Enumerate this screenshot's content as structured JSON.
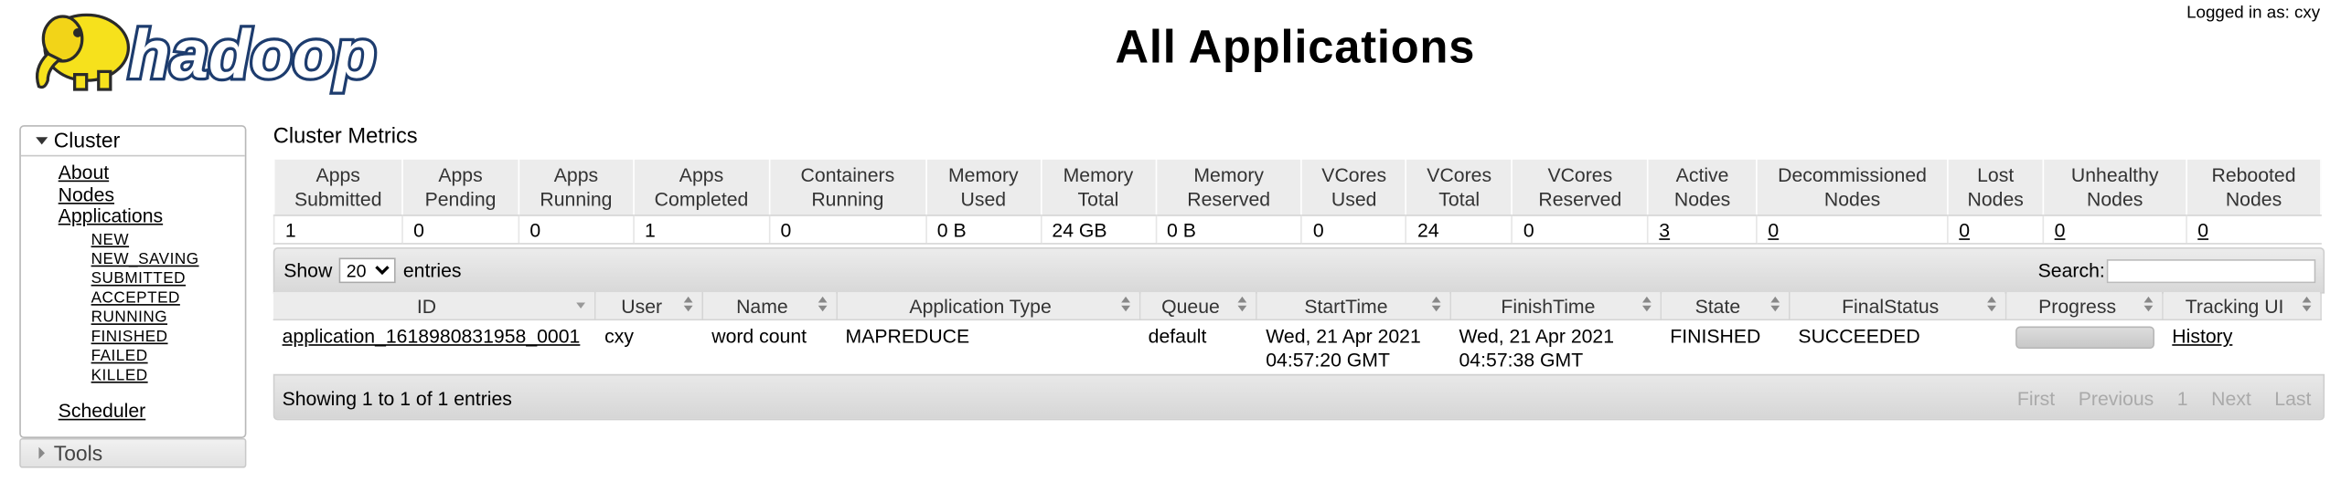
{
  "header": {
    "logo_text": "hadoop",
    "title": "All Applications",
    "logged_in": "Logged in as: cxy"
  },
  "sidebar": {
    "cluster_label": "Cluster",
    "links": [
      "About",
      "Nodes",
      "Applications"
    ],
    "app_states": [
      "NEW",
      "NEW_SAVING",
      "SUBMITTED",
      "ACCEPTED",
      "RUNNING",
      "FINISHED",
      "FAILED",
      "KILLED"
    ],
    "scheduler": "Scheduler",
    "tools_label": "Tools"
  },
  "metrics": {
    "title": "Cluster Metrics",
    "headers": [
      [
        "Apps",
        "Submitted"
      ],
      [
        "Apps",
        "Pending"
      ],
      [
        "Apps",
        "Running"
      ],
      [
        "Apps",
        "Completed"
      ],
      [
        "Containers",
        "Running"
      ],
      [
        "Memory",
        "Used"
      ],
      [
        "Memory",
        "Total"
      ],
      [
        "Memory",
        "Reserved"
      ],
      [
        "VCores",
        "Used"
      ],
      [
        "VCores",
        "Total"
      ],
      [
        "VCores",
        "Reserved"
      ],
      [
        "Active",
        "Nodes"
      ],
      [
        "Decommissioned",
        "Nodes"
      ],
      [
        "Lost",
        "Nodes"
      ],
      [
        "Unhealthy",
        "Nodes"
      ],
      [
        "Rebooted",
        "Nodes"
      ]
    ],
    "values": [
      "1",
      "0",
      "0",
      "1",
      "0",
      "0 B",
      "24 GB",
      "0 B",
      "0",
      "24",
      "0",
      "3",
      "0",
      "0",
      "0",
      "0"
    ]
  },
  "table_controls": {
    "show": "Show",
    "page_size": "20",
    "entries": "entries",
    "search_label": "Search:"
  },
  "apps": {
    "columns": [
      "ID",
      "User",
      "Name",
      "Application Type",
      "Queue",
      "StartTime",
      "FinishTime",
      "State",
      "FinalStatus",
      "Progress",
      "Tracking UI"
    ],
    "rows": [
      {
        "id": "application_1618980831958_0001",
        "user": "cxy",
        "name": "word count",
        "type": "MAPREDUCE",
        "queue": "default",
        "start_date": "Wed, 21 Apr 2021",
        "start_time": "04:57:20 GMT",
        "finish_date": "Wed, 21 Apr 2021",
        "finish_time": "04:57:38 GMT",
        "state": "FINISHED",
        "final_status": "SUCCEEDED",
        "progress": 1.0,
        "tracking": "History"
      }
    ]
  },
  "footer": {
    "info": "Showing 1 to 1 of 1 entries",
    "pager": [
      "First",
      "Previous",
      "1",
      "Next",
      "Last"
    ]
  },
  "colors": {
    "header_bg": "#ececec",
    "toolbar_bg": "#dcdcdc",
    "logo_yellow": "#f6e11c",
    "logo_blue": "#1d3c6e"
  }
}
